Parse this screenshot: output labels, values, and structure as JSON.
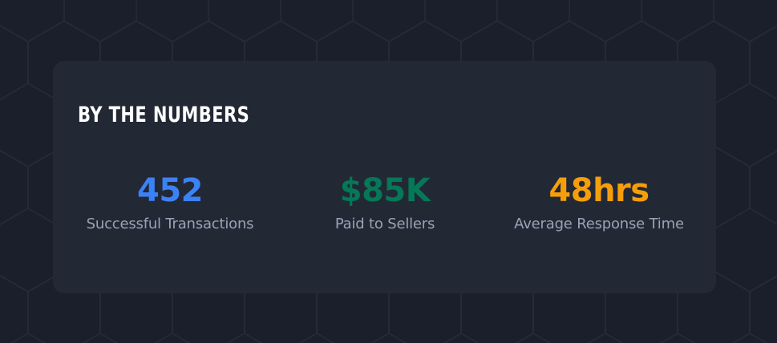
{
  "section": {
    "title": "BY THE NUMBERS"
  },
  "stats": [
    {
      "value": "452",
      "label": "Successful Transactions",
      "color": "#3b82f6"
    },
    {
      "value": "$85K",
      "label": "Paid to Sellers",
      "color": "#047857"
    },
    {
      "value": "48hrs",
      "label": "Average Response Time",
      "color": "#f59e0b"
    }
  ],
  "colors": {
    "background": "#1b1f2b",
    "card": "#232835",
    "title": "#ffffff",
    "label": "#9aa3b5",
    "pattern": "#262b38"
  },
  "background_pattern": "hexagon-outline"
}
